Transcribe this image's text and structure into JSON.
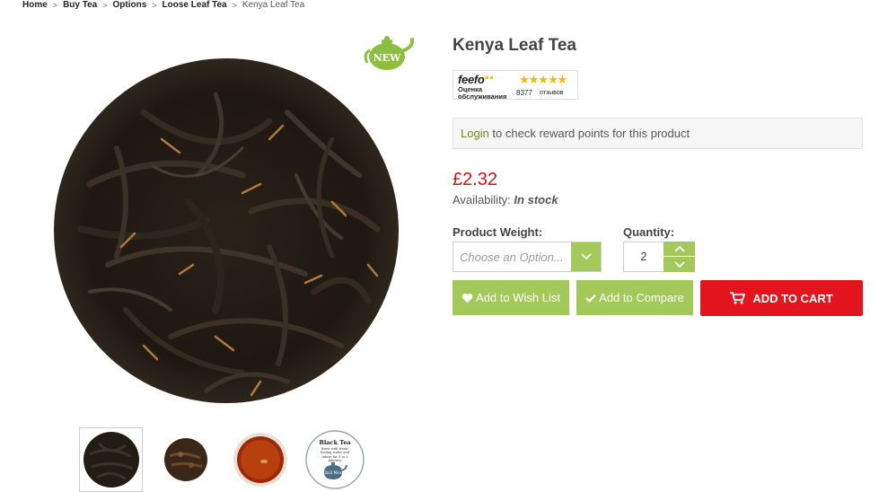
{
  "breadcrumb": {
    "items": [
      "Home",
      "Buy Tea",
      "Options",
      "Loose Leaf Tea"
    ],
    "current": "Kenya Leaf Tea"
  },
  "gallery": {
    "badge_text": "NEW",
    "thumb_label": "Black Tea",
    "thumb_note": "Brew with fresh-boiling water and infuse for 3 to 5 minutes",
    "thumb_time": "3to5 Mins"
  },
  "product": {
    "title": "Kenya Leaf Tea",
    "price": "£2.32",
    "availability_label": "Availability:",
    "availability_value": "In stock"
  },
  "feefo": {
    "logo": "feefo",
    "stars": "★★★★★",
    "rating_label": "Оценка обслуживания",
    "count": "8377",
    "reviews_label": "отзывов"
  },
  "reward": {
    "login_label": "Login",
    "text": " to check reward points for this product"
  },
  "options": {
    "weight_label": "Product Weight:",
    "weight_placeholder": "Choose an Option...",
    "quantity_label": "Quantity:",
    "quantity_value": "2"
  },
  "actions": {
    "wishlist_label": "Add to Wish List",
    "compare_label": "Add to Compare",
    "cart_label": "ADD TO CART"
  },
  "colors": {
    "accent_green": "#a3c95b",
    "cart_red": "#e3141d",
    "price_red": "#d0121b",
    "login_green": "#6a8a1a"
  }
}
